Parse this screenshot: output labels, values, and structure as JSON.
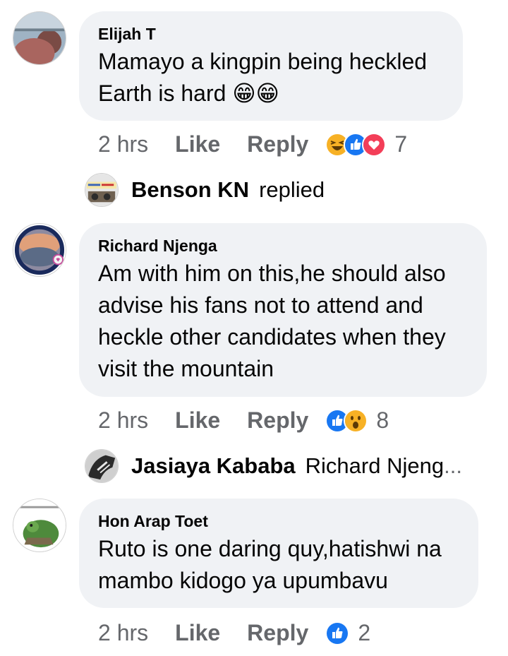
{
  "comments": [
    {
      "author": "Elijah T",
      "text_lines": [
        "Mamayo a kingpin being heckled",
        "Earth is hard 😁😁"
      ],
      "time": "2 hrs",
      "like_label": "Like",
      "reply_label": "Reply",
      "reactions": [
        "haha-icon",
        "like-icon",
        "love-icon"
      ],
      "reaction_count": "7",
      "replies": {
        "name": "Benson KN",
        "note": "replied"
      }
    },
    {
      "author": "Richard Njenga",
      "text_lines": [
        "Am with him on this,he should also",
        "advise his fans not to attend and",
        "heckle other candidates when they",
        "visit the mountain"
      ],
      "time": "2 hrs",
      "like_label": "Like",
      "reply_label": "Reply",
      "reactions": [
        "like-icon",
        "wow-icon"
      ],
      "reaction_count": "8",
      "replies": {
        "name": "Jasiaya Kababa",
        "note": "Richard Njeng",
        "ellipsis": "..."
      }
    },
    {
      "author": "Hon Arap Toet",
      "text_lines": [
        "Ruto is one daring quy,hatishwi na",
        "mambo kidogo ya upumbavu"
      ],
      "time": "2 hrs",
      "like_label": "Like",
      "reply_label": "Reply",
      "reactions": [
        "like-icon"
      ],
      "reaction_count": "2"
    }
  ],
  "colors": {
    "bubble_bg": "#f0f2f5",
    "meta_text": "#65676b",
    "like_blue": "#1877f2",
    "love_red": "#f33e58",
    "haha_yellow": "#f7b125"
  }
}
